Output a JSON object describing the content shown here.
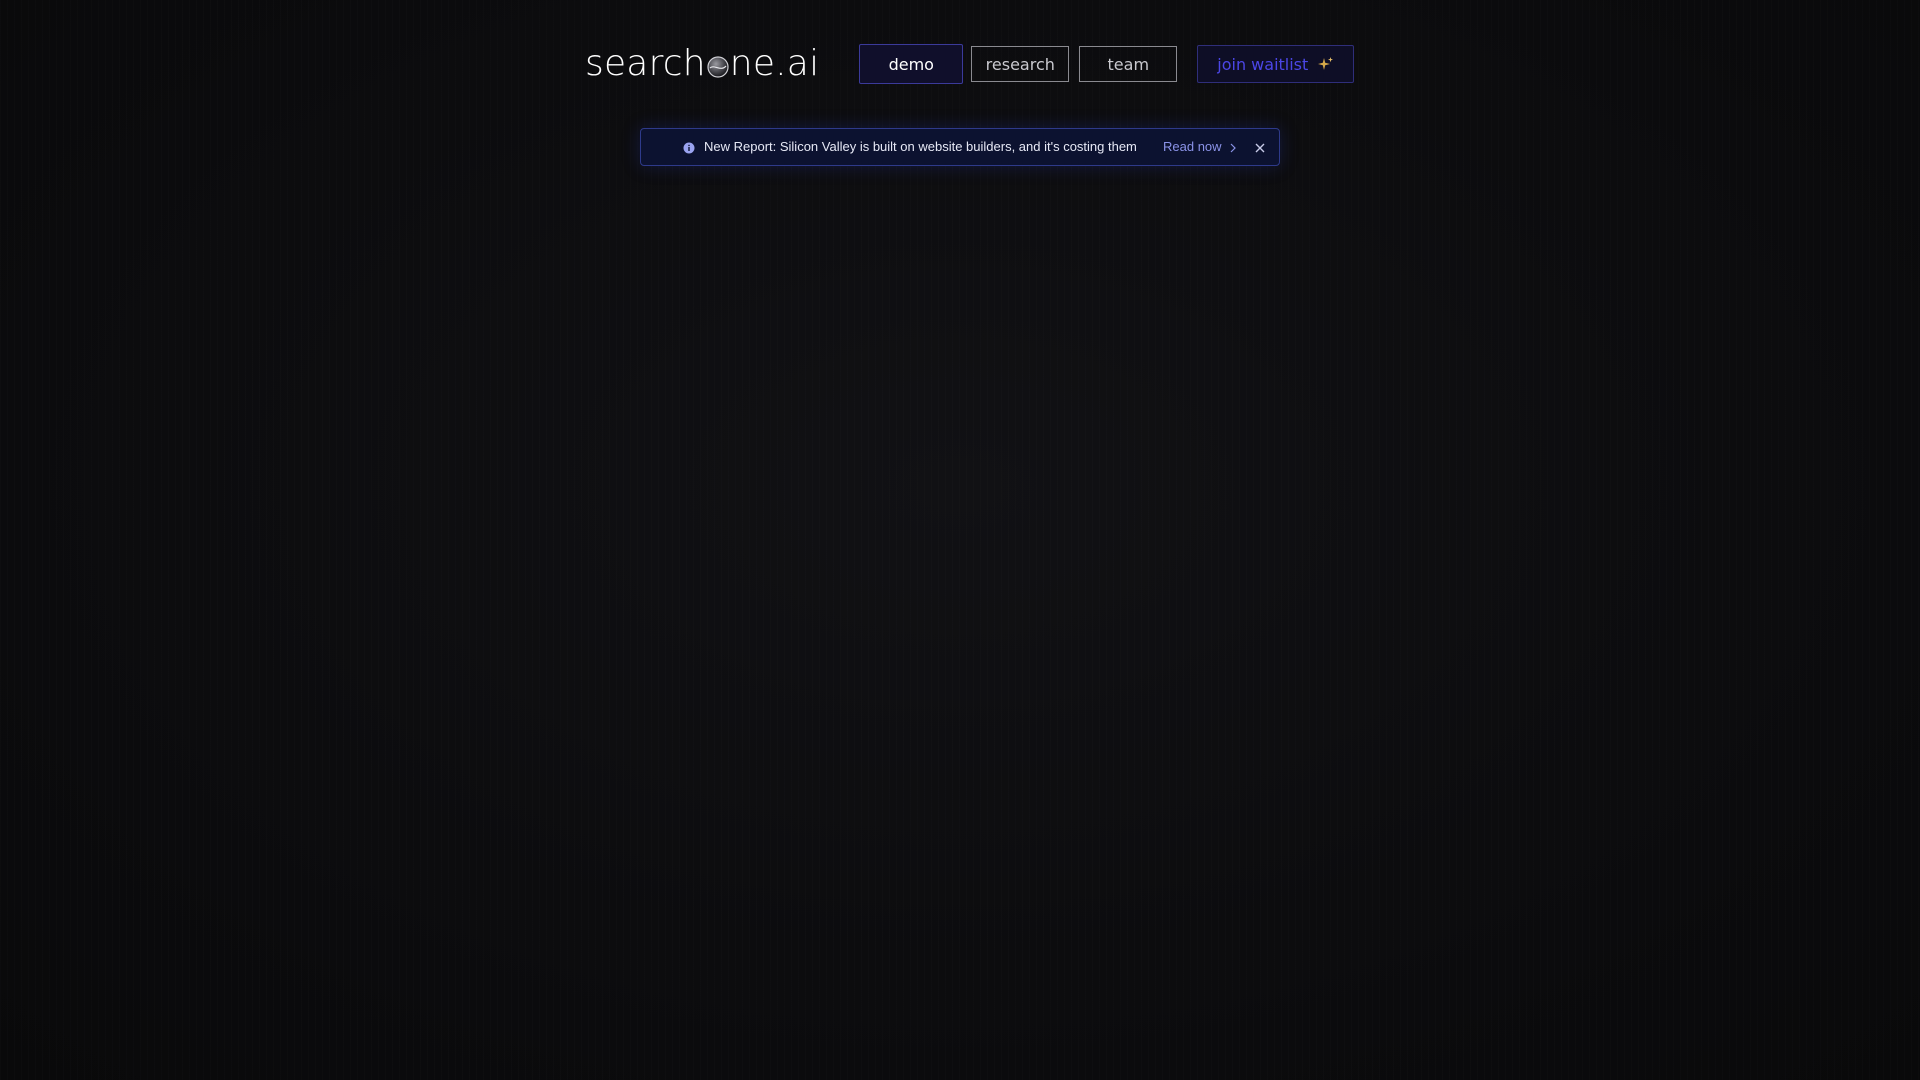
{
  "header": {
    "logo_text_pre": "search",
    "logo_text_post": "ne.ai",
    "nav": {
      "demo": "demo",
      "research": "research",
      "team": "team",
      "waitlist": "join waitlist"
    }
  },
  "banner": {
    "message": "New Report: Silicon Valley is built on website builders, and it's costing them",
    "link": "Read now"
  },
  "icons": {
    "logo_orb": "globe-orb-icon",
    "sparkle": "sparkle-icon",
    "info": "info-icon",
    "chevron": "chevron-right-icon",
    "close": "close-icon"
  },
  "colors": {
    "background": "#0c0c0e",
    "accent": "#4b46e6",
    "banner_bg": "#0c1230",
    "banner_border": "#2e3a8a"
  }
}
